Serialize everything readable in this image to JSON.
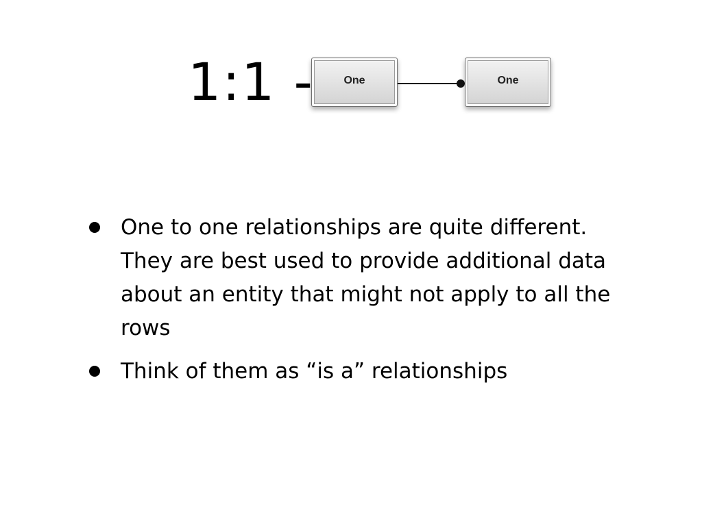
{
  "slide": {
    "title": "1:1 -",
    "diagram": {
      "left_entity": "One",
      "right_entity": "One"
    },
    "bullets": [
      "One to one relationships are quite different. They are best used to provide additional data about an entity that might not apply to all the rows",
      "Think of them as “is a” relationships"
    ]
  },
  "colors": {
    "background": "#ffffff",
    "text": "#000000",
    "entity_fill": "#e2e2e2",
    "connector": "#111111"
  }
}
